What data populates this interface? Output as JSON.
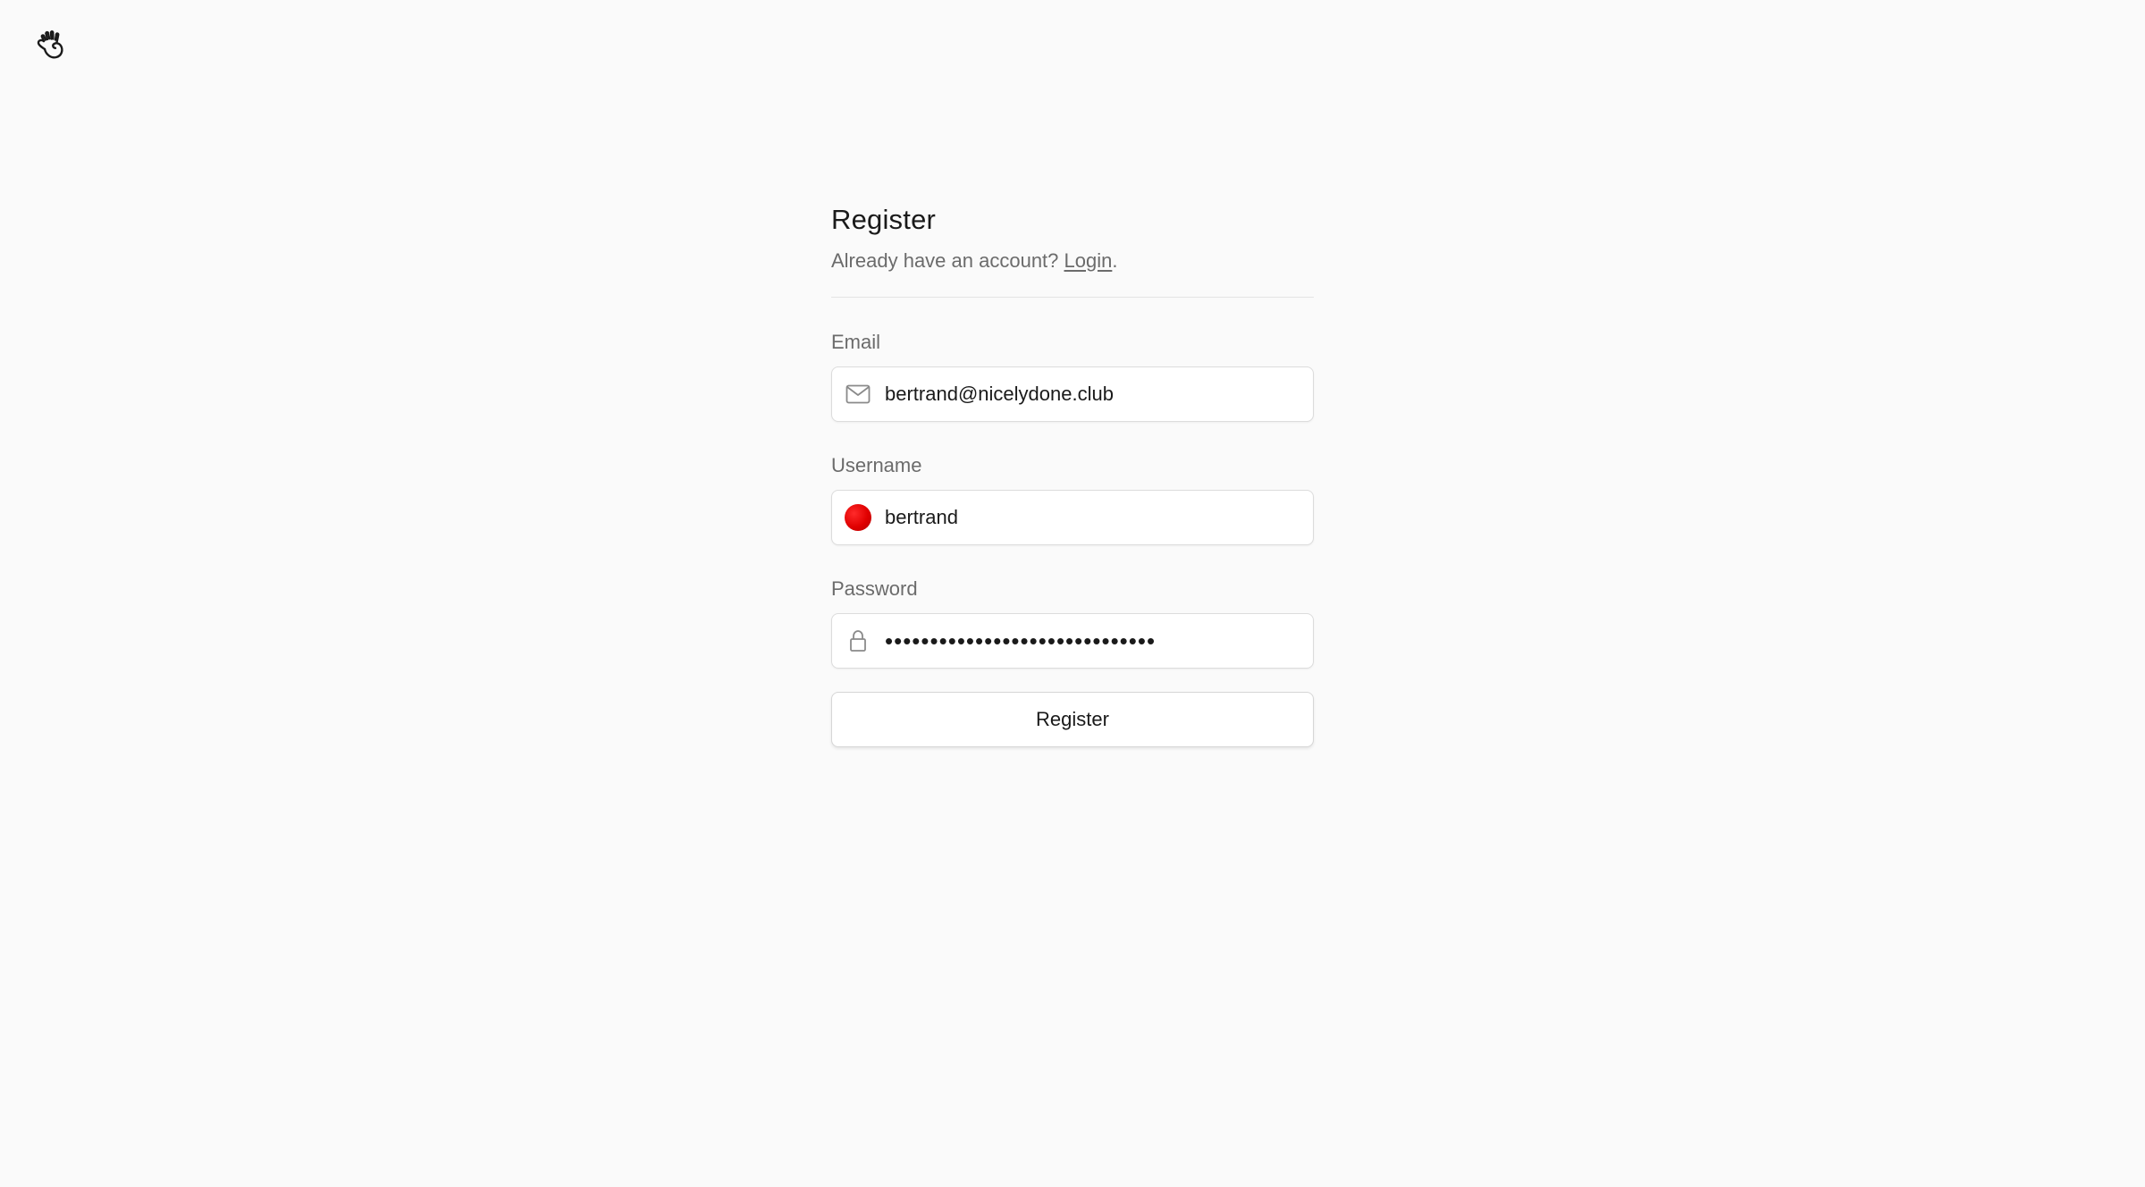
{
  "app": {
    "logo_icon": "hand-wave-icon"
  },
  "form": {
    "title": "Register",
    "subtitle_prefix": "Already have an account? ",
    "login_link": "Login",
    "subtitle_suffix": ".",
    "email": {
      "label": "Email",
      "value": "bertrand@nicelydone.club",
      "icon": "envelope-icon"
    },
    "username": {
      "label": "Username",
      "value": "bertrand",
      "avatar_color": "#e60000"
    },
    "password": {
      "label": "Password",
      "value": "••••••••••••••••••••••••••••••",
      "icon": "lock-icon"
    },
    "submit_label": "Register"
  }
}
